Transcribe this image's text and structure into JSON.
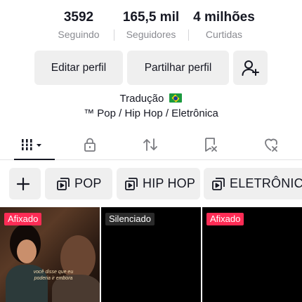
{
  "stats": [
    {
      "value": "3592",
      "label": "Seguindo"
    },
    {
      "value": "165,5 mil",
      "label": "Seguidores"
    },
    {
      "value": "4 milhões",
      "label": "Curtidas"
    }
  ],
  "actions": {
    "edit_profile": "Editar perfil",
    "share_profile": "Partilhar perfil",
    "add_user_icon": "add-user-icon"
  },
  "bio": {
    "line1": "Tradução",
    "flag": "brazil-flag",
    "line2": "™ Pop / Hip Hop / Eletrônica"
  },
  "tabs": [
    {
      "icon": "grid-icon",
      "active": true,
      "has_dropdown": true
    },
    {
      "icon": "lock-icon",
      "active": false
    },
    {
      "icon": "repost-icon",
      "active": false
    },
    {
      "icon": "bookmark-icon",
      "active": false
    },
    {
      "icon": "liked-hidden-icon",
      "active": false
    }
  ],
  "playlists": {
    "add_label": "+",
    "items": [
      {
        "label": "POP"
      },
      {
        "label": "HIP HOP"
      },
      {
        "label": "ELETRÔNICA"
      }
    ]
  },
  "videos": [
    {
      "badge": "Afixado",
      "caption": "você disse que eu poderia ir embora"
    },
    {
      "badge": "Silenciado",
      "caption": ""
    },
    {
      "badge": "Afixado",
      "caption": ""
    }
  ],
  "colors": {
    "text": "#161823",
    "muted": "#8a8b91",
    "button_bg": "#efefef",
    "pinned_badge": "#fe2c55"
  }
}
